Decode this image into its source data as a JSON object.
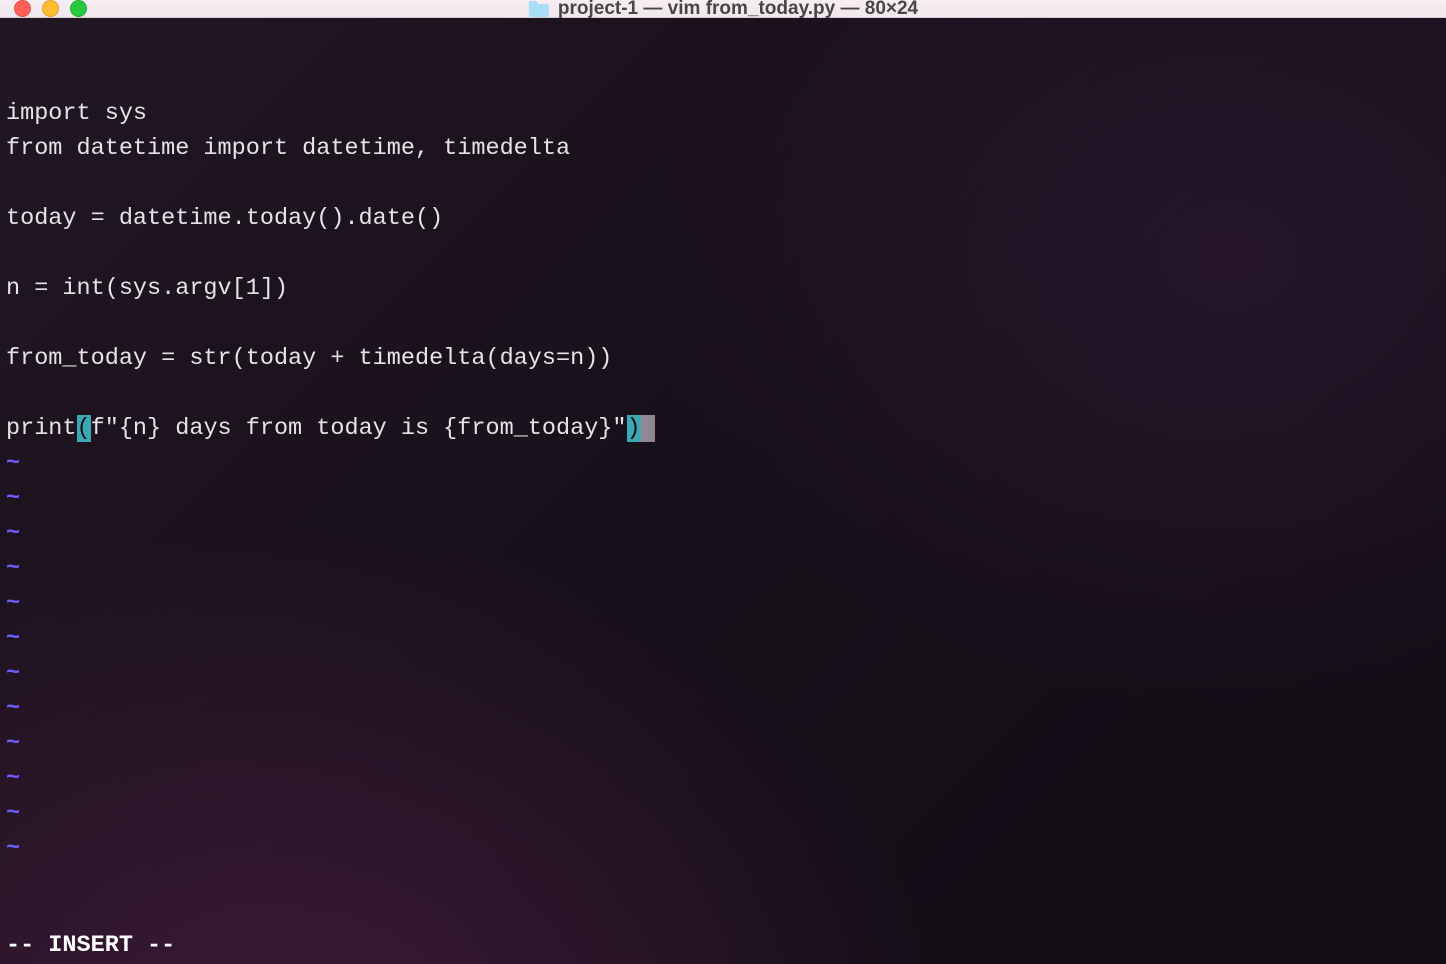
{
  "titlebar": {
    "title": "project-1 — vim from_today.py — 80×24"
  },
  "editor": {
    "lines": [
      "import sys",
      "from datetime import datetime, timedelta",
      "",
      "today = datetime.today().date()",
      "",
      "n = int(sys.argv[1])",
      "",
      "from_today = str(today + timedelta(days=n))",
      ""
    ],
    "final_line_prefix": "print",
    "final_line_open_paren": "(",
    "final_line_middle": "f\"{n} days from today is {from_today}\"",
    "final_line_close_paren": ")",
    "cursor_char": " ",
    "tilde": "~",
    "empty_tilde_count": 12,
    "status": "-- INSERT --"
  }
}
